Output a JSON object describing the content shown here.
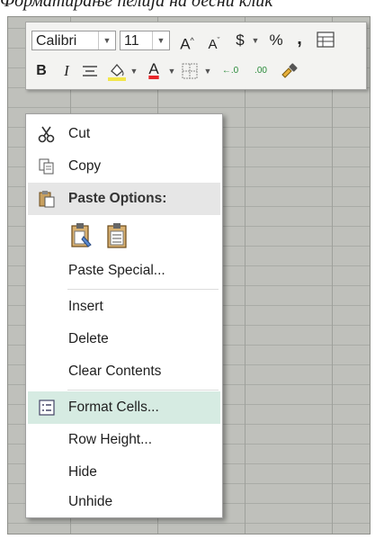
{
  "caption": "Форматирање ћелија на десни клик",
  "mini_toolbar": {
    "font_name": "Calibri",
    "font_size": "11",
    "increase_font": "A",
    "decrease_font": "A",
    "currency": "$",
    "percent": "%",
    "comma": ",",
    "bold": "B",
    "italic": "I",
    "font_color_letter": "A",
    "inc_decimal": "←.0",
    "dec_decimal": ".00"
  },
  "context_menu": {
    "cut": "Cut",
    "copy": "Copy",
    "paste_options": "Paste Options:",
    "paste_special": "Paste Special...",
    "insert": "Insert",
    "delete": "Delete",
    "clear_contents": "Clear Contents",
    "format_cells": "Format Cells...",
    "row_height": "Row Height...",
    "hide": "Hide",
    "unhide": "Unhide"
  },
  "colors": {
    "highlight": "#d6ebe2",
    "font_color_bar": "#e8262a",
    "fill_color_bar": "#f2e64a"
  }
}
